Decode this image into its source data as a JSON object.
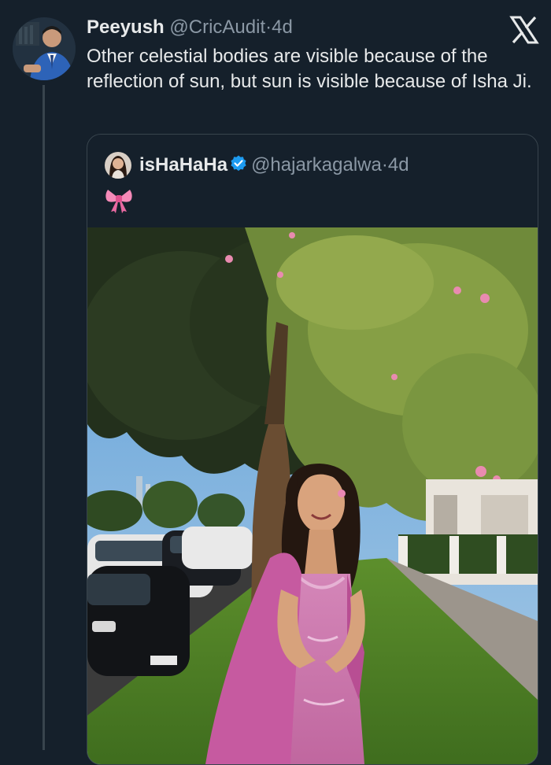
{
  "tweet": {
    "author_name": "Peeyush",
    "author_handle": "@CricAudit",
    "separator": "·",
    "time": "4d",
    "text": "Other celestial bodies are visible because of the reflection of sun, but sun is visible because of Isha Ji.",
    "avatar_icon": "person-avatar",
    "platform_icon": "x-logo-icon"
  },
  "quote": {
    "author_name": "isHaHaHa",
    "verified_icon": "verified-badge-icon",
    "author_handle": "@hajarkagalwa",
    "separator": "·",
    "time": "4d",
    "text_emoji_icon": "pink-ribbon-bow-icon",
    "media_icon": "photo-woman-pink-dress-under-tree"
  },
  "colors": {
    "background": "#15202b",
    "text_primary": "#e7e9ea",
    "text_secondary": "#8b98a5",
    "border": "#38444d",
    "verified_blue": "#1d9bf0"
  }
}
